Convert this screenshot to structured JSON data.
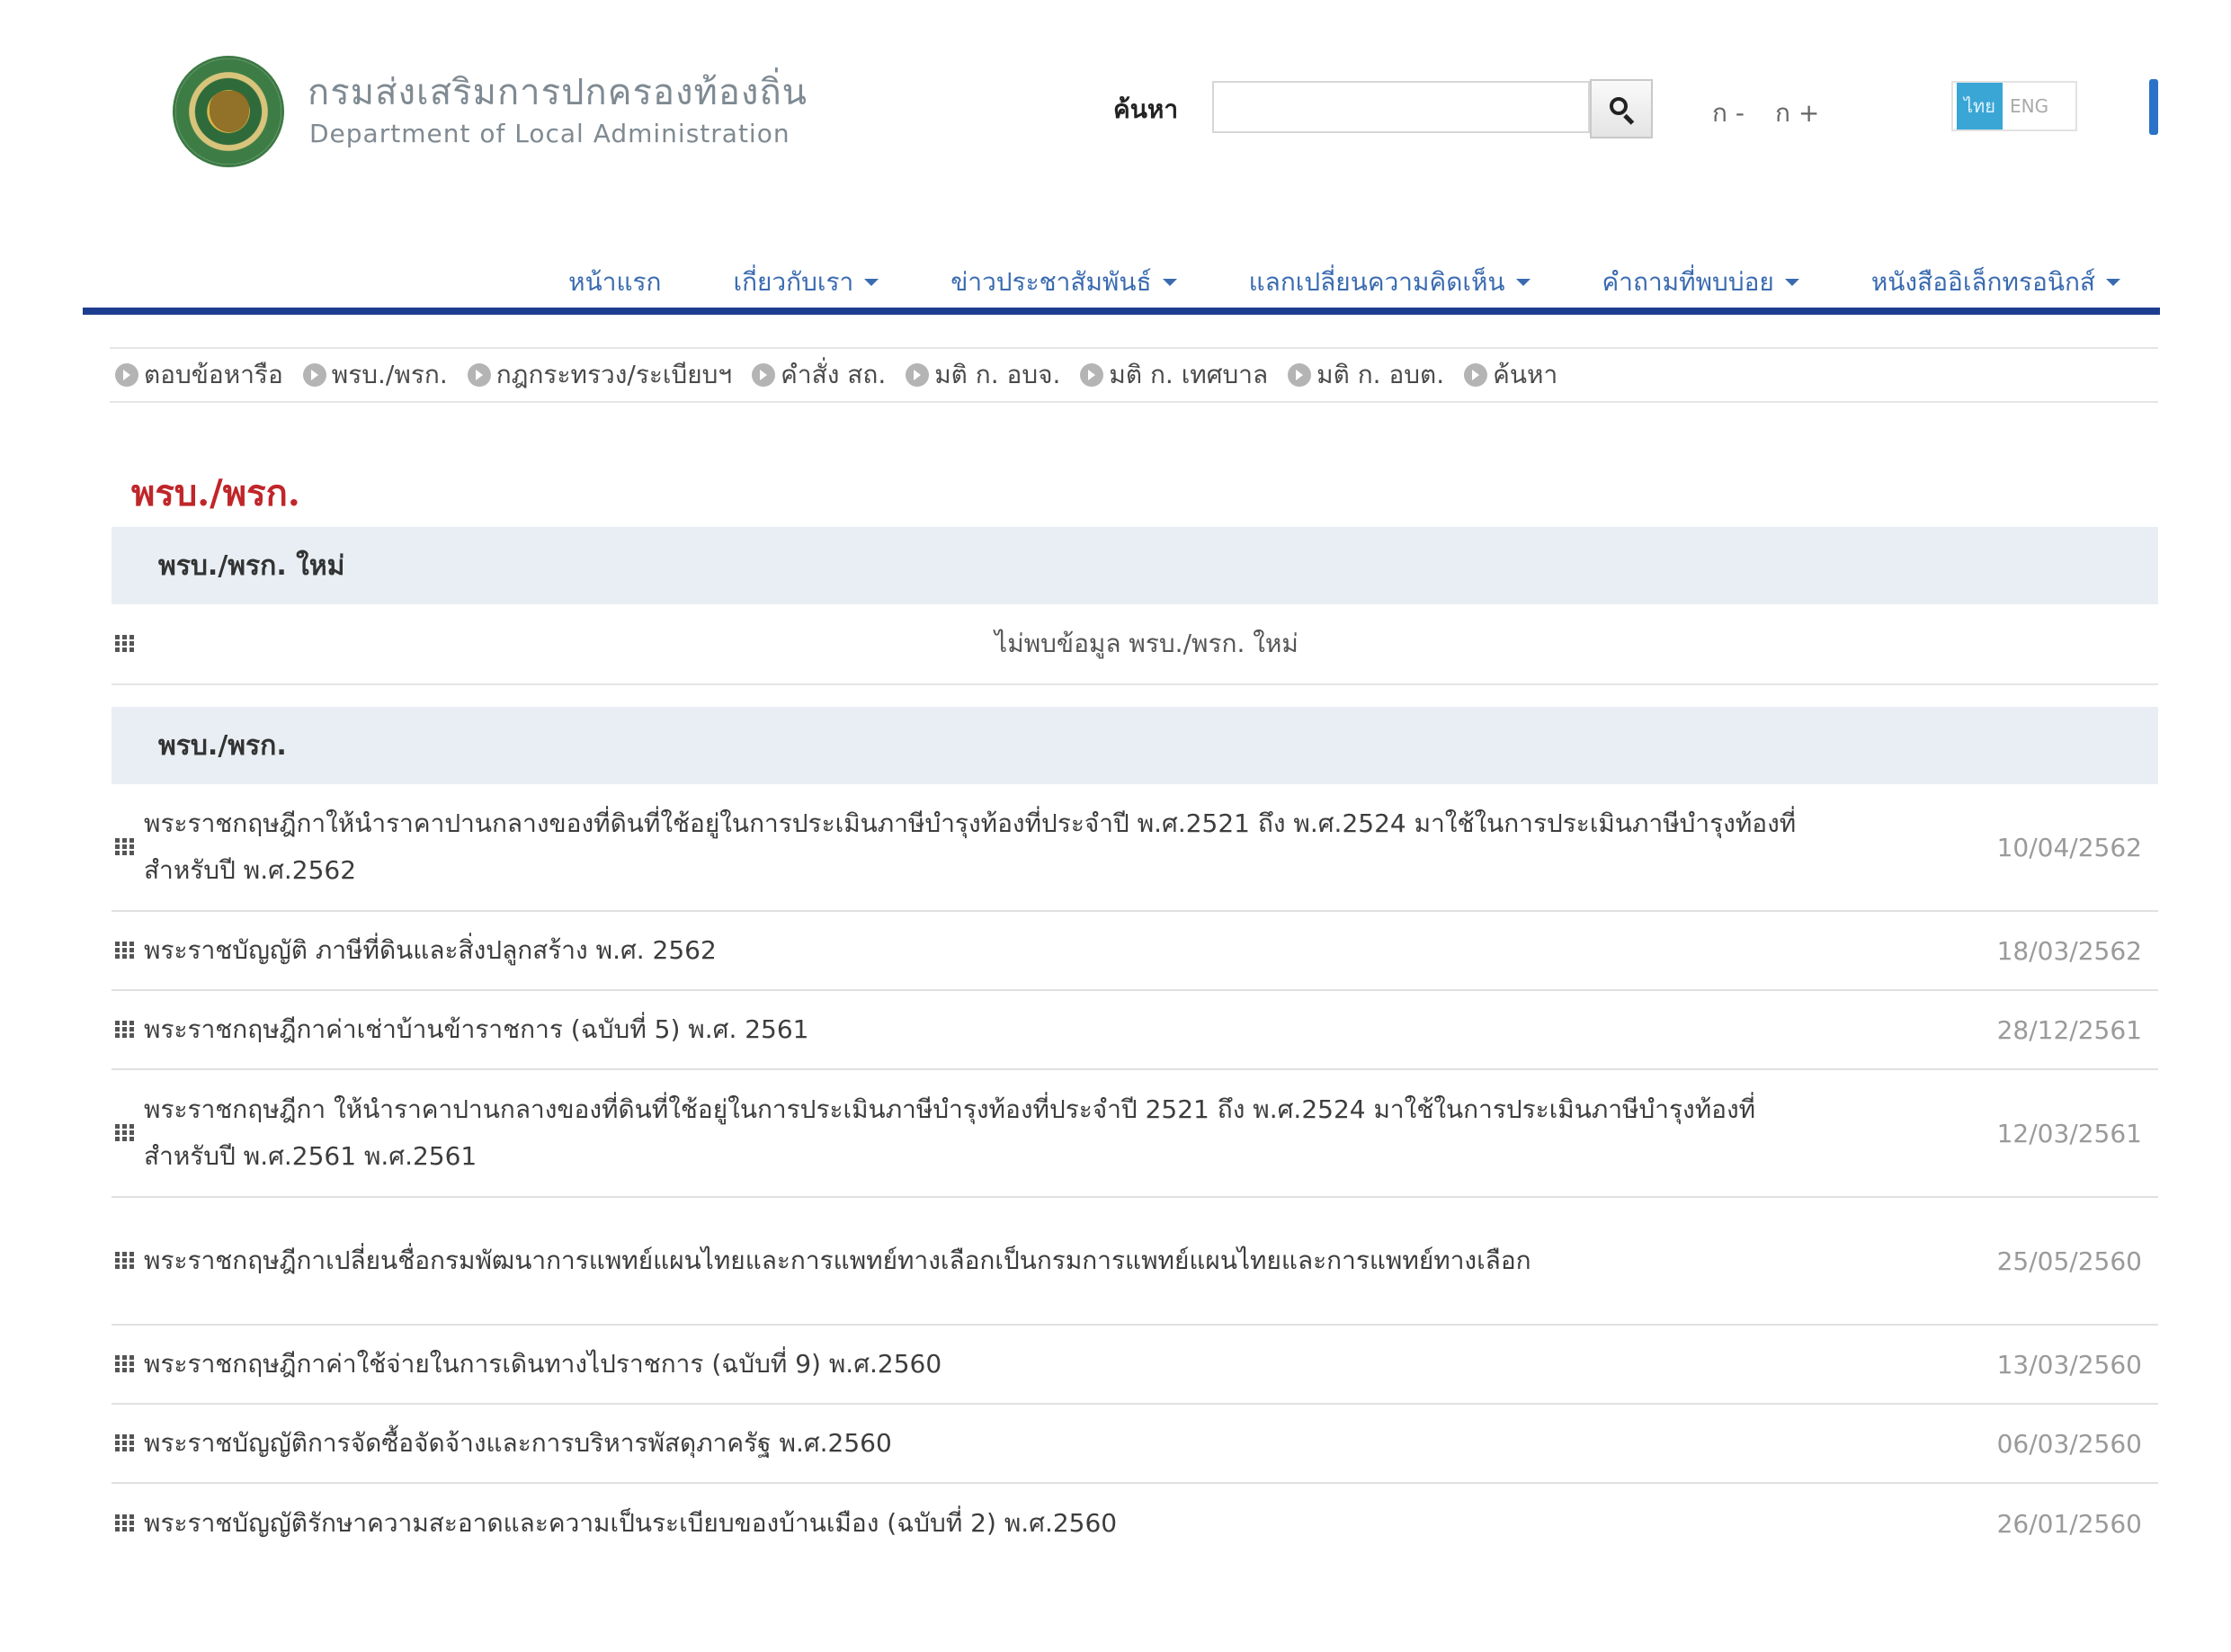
{
  "header": {
    "title_th": "กรมส่งเสริมการปกครองท้องถิ่น",
    "title_en": "Department of Local Administration",
    "search_label": "ค้นหา",
    "search_value": "",
    "font_decrease": "ก -",
    "font_increase": "ก +",
    "lang_th": "ไทย",
    "lang_en": "ENG"
  },
  "nav": {
    "items": [
      {
        "label": "หน้าแรก",
        "dropdown": false
      },
      {
        "label": "เกี่ยวกับเรา",
        "dropdown": true
      },
      {
        "label": "ข่าวประชาสัมพันธ์",
        "dropdown": true
      },
      {
        "label": "แลกเปลี่ยนความคิดเห็น",
        "dropdown": true
      },
      {
        "label": "คำถามที่พบบ่อย",
        "dropdown": true
      },
      {
        "label": "หนังสืออิเล็กทรอนิกส์",
        "dropdown": true
      }
    ]
  },
  "submenu": {
    "items": [
      "ตอบข้อหารือ",
      "พรบ./พรก.",
      "กฎกระทรวง/ระเบียบฯ",
      "คำสั่ง สถ.",
      "มติ ก. อบจ.",
      "มติ ก. เทศบาล",
      "มติ ก. อบต.",
      "ค้นหา"
    ]
  },
  "content": {
    "heading": "พรบ./พรก.",
    "new_section_title": "พรบ./พรก. ใหม่",
    "new_section_empty": "ไม่พบข้อมูล พรบ./พรก. ใหม่",
    "list_section_title": "พรบ./พรก.",
    "rows": [
      {
        "title": "พระราชกฤษฎีกาให้นำราคาปานกลางของที่ดินที่ใช้อยู่ในการประเมินภาษีบำรุงท้องที่ประจำปี พ.ศ.2521 ถึง พ.ศ.2524 มาใช้ในการประเมินภาษีบำรุงท้องที่สำหรับปี พ.ศ.2562",
        "date": "10/04/2562"
      },
      {
        "title": "พระราชบัญญัติ ภาษีที่ดินและสิ่งปลูกสร้าง พ.ศ. 2562",
        "date": "18/03/2562"
      },
      {
        "title": "พระราชกฤษฎีกาค่าเช่าบ้านข้าราชการ (ฉบับที่ 5) พ.ศ. 2561",
        "date": "28/12/2561"
      },
      {
        "title": "พระราชกฤษฎีกา ให้นำราคาปานกลางของที่ดินที่ใช้อยู่ในการประเมินภาษีบำรุงท้องที่ประจำปี 2521 ถึง พ.ศ.2524 มาใช้ในการประเมินภาษีบำรุงท้องที่สำหรับปี พ.ศ.2561 พ.ศ.2561",
        "date": "12/03/2561"
      },
      {
        "title": "พระราชกฤษฎีกาเปลี่ยนชื่อกรมพัฒนาการแพทย์แผนไทยและการแพทย์ทางเลือกเป็นกรมการแพทย์แผนไทยและการแพทย์ทางเลือก",
        "date": "25/05/2560"
      },
      {
        "title": "พระราชกฤษฎีกาค่าใช้จ่ายในการเดินทางไปราชการ (ฉบับที่ 9) พ.ศ.2560",
        "date": "13/03/2560"
      },
      {
        "title": "พระราชบัญญัติการจัดซื้อจัดจ้างและการบริหารพัสดุภาครัฐ พ.ศ.2560",
        "date": "06/03/2560"
      },
      {
        "title": "พระราชบัญญัติรักษาความสะอาดและความเป็นระเบียบของบ้านเมือง (ฉบับที่ 2) พ.ศ.2560",
        "date": "26/01/2560"
      }
    ]
  }
}
